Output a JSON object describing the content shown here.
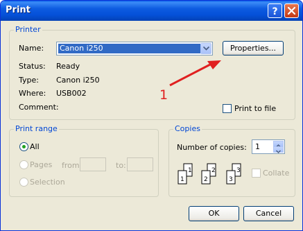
{
  "window": {
    "title": "Print"
  },
  "printer": {
    "group_label": "Printer",
    "name_label": "Name:",
    "name_value": "Canon i250",
    "properties_button": "Properties...",
    "status_label": "Status:",
    "status_value": "Ready",
    "type_label": "Type:",
    "type_value": "Canon i250",
    "where_label": "Where:",
    "where_value": "USB002",
    "comment_label": "Comment:",
    "comment_value": "",
    "print_to_file_label": "Print to file"
  },
  "print_range": {
    "group_label": "Print range",
    "all_label": "All",
    "pages_label": "Pages",
    "from_label": "from:",
    "to_label": "to:",
    "selection_label": "Selection"
  },
  "copies": {
    "group_label": "Copies",
    "number_label": "Number of copies:",
    "number_value": "1",
    "collate_label": "Collate",
    "collate_pages": [
      "1",
      "1",
      "2",
      "2",
      "3",
      "3"
    ]
  },
  "buttons": {
    "ok": "OK",
    "cancel": "Cancel"
  },
  "annotation": {
    "label": "1",
    "color": "#e02020"
  },
  "colors": {
    "titlebar": "#0451d9",
    "group_label": "#0046d5",
    "selection": "#316ac5"
  }
}
